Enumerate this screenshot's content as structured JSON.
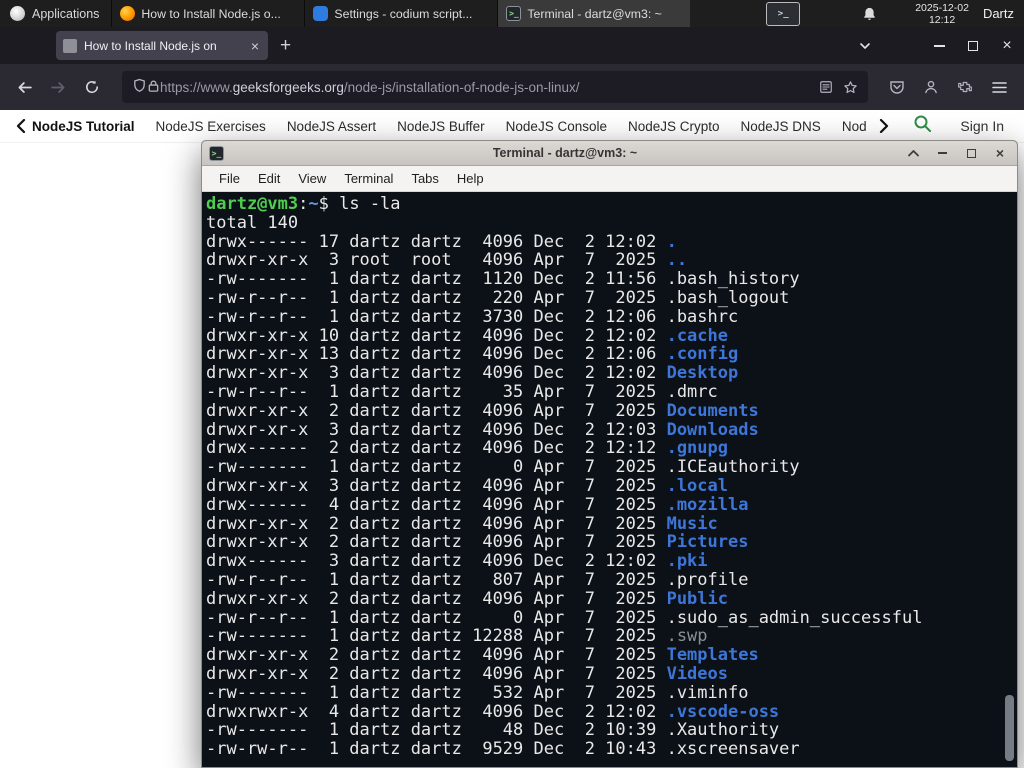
{
  "colors": {
    "gfg_green": "#2f8d46",
    "dir_blue": "#3d76d8",
    "prompt_green": "#4fce4f",
    "terminal_bg": "#0c1117",
    "firefox_dark": "#2b2a33"
  },
  "panel": {
    "applications_label": "Applications",
    "tasks": [
      {
        "title": "How to Install Node.js o...",
        "icon": "firefox",
        "active": false
      },
      {
        "title": "Settings - codium script...",
        "icon": "settings",
        "active": false
      },
      {
        "title": "Terminal - dartz@vm3: ~",
        "icon": "terminal",
        "active": true
      }
    ],
    "tray_glyph": ">_",
    "clock_date": "2025-12-02",
    "clock_time": "12:12",
    "user_label": "Dartz"
  },
  "browser": {
    "tab_title": "How to Install Node.js on",
    "tab_close": "×",
    "new_tab": "+",
    "url_prefix": "https://www.",
    "url_domain": "geeksforgeeks.org",
    "url_path": "/node-js/installation-of-node-js-on-linux/",
    "window_close": "×"
  },
  "sitenav": {
    "items": [
      "NodeJS Tutorial",
      "NodeJS Exercises",
      "NodeJS Assert",
      "NodeJS Buffer",
      "NodeJS Console",
      "NodeJS Crypto",
      "NodeJS DNS",
      "Node"
    ],
    "signin": "Sign In"
  },
  "terminal": {
    "title": "Terminal - dartz@vm3: ~",
    "menus": [
      "File",
      "Edit",
      "View",
      "Terminal",
      "Tabs",
      "Help"
    ],
    "prompt": {
      "userhost": "dartz@vm3",
      "colon": ":",
      "path": "~",
      "dollar": "$ ",
      "command": "ls -la"
    },
    "total_line": "total 140",
    "lines": [
      {
        "pre": "drwx------ 17 dartz dartz  4096 Dec  2 12:02 ",
        "name": ".",
        "c": "dir"
      },
      {
        "pre": "drwxr-xr-x  3 root  root   4096 Apr  7  2025 ",
        "name": "..",
        "c": "dir"
      },
      {
        "pre": "-rw-------  1 dartz dartz  1120 Dec  2 11:56 ",
        "name": ".bash_history",
        "c": "plain"
      },
      {
        "pre": "-rw-r--r--  1 dartz dartz   220 Apr  7  2025 ",
        "name": ".bash_logout",
        "c": "plain"
      },
      {
        "pre": "-rw-r--r--  1 dartz dartz  3730 Dec  2 12:06 ",
        "name": ".bashrc",
        "c": "plain"
      },
      {
        "pre": "drwxr-xr-x 10 dartz dartz  4096 Dec  2 12:02 ",
        "name": ".cache",
        "c": "dir"
      },
      {
        "pre": "drwxr-xr-x 13 dartz dartz  4096 Dec  2 12:06 ",
        "name": ".config",
        "c": "dir"
      },
      {
        "pre": "drwxr-xr-x  3 dartz dartz  4096 Dec  2 12:02 ",
        "name": "Desktop",
        "c": "dir"
      },
      {
        "pre": "-rw-r--r--  1 dartz dartz    35 Apr  7  2025 ",
        "name": ".dmrc",
        "c": "plain"
      },
      {
        "pre": "drwxr-xr-x  2 dartz dartz  4096 Apr  7  2025 ",
        "name": "Documents",
        "c": "dir"
      },
      {
        "pre": "drwxr-xr-x  3 dartz dartz  4096 Dec  2 12:03 ",
        "name": "Downloads",
        "c": "dir"
      },
      {
        "pre": "drwx------  2 dartz dartz  4096 Dec  2 12:12 ",
        "name": ".gnupg",
        "c": "dir"
      },
      {
        "pre": "-rw-------  1 dartz dartz     0 Apr  7  2025 ",
        "name": ".ICEauthority",
        "c": "plain"
      },
      {
        "pre": "drwxr-xr-x  3 dartz dartz  4096 Apr  7  2025 ",
        "name": ".local",
        "c": "dir"
      },
      {
        "pre": "drwx------  4 dartz dartz  4096 Apr  7  2025 ",
        "name": ".mozilla",
        "c": "dir"
      },
      {
        "pre": "drwxr-xr-x  2 dartz dartz  4096 Apr  7  2025 ",
        "name": "Music",
        "c": "dir"
      },
      {
        "pre": "drwxr-xr-x  2 dartz dartz  4096 Apr  7  2025 ",
        "name": "Pictures",
        "c": "dir"
      },
      {
        "pre": "drwx------  3 dartz dartz  4096 Dec  2 12:02 ",
        "name": ".pki",
        "c": "dir"
      },
      {
        "pre": "-rw-r--r--  1 dartz dartz   807 Apr  7  2025 ",
        "name": ".profile",
        "c": "plain"
      },
      {
        "pre": "drwxr-xr-x  2 dartz dartz  4096 Apr  7  2025 ",
        "name": "Public",
        "c": "dir"
      },
      {
        "pre": "-rw-r--r--  1 dartz dartz     0 Apr  7  2025 ",
        "name": ".sudo_as_admin_successful",
        "c": "plain"
      },
      {
        "pre": "-rw-------  1 dartz dartz 12288 Apr  7  2025 ",
        "name": ".swp",
        "c": "dim"
      },
      {
        "pre": "drwxr-xr-x  2 dartz dartz  4096 Apr  7  2025 ",
        "name": "Templates",
        "c": "dir"
      },
      {
        "pre": "drwxr-xr-x  2 dartz dartz  4096 Apr  7  2025 ",
        "name": "Videos",
        "c": "dir"
      },
      {
        "pre": "-rw-------  1 dartz dartz   532 Apr  7  2025 ",
        "name": ".viminfo",
        "c": "plain"
      },
      {
        "pre": "drwxrwxr-x  4 dartz dartz  4096 Dec  2 12:02 ",
        "name": ".vscode-oss",
        "c": "dir"
      },
      {
        "pre": "-rw-------  1 dartz dartz    48 Dec  2 10:39 ",
        "name": ".Xauthority",
        "c": "plain"
      },
      {
        "pre": "-rw-rw-r--  1 dartz dartz  9529 Dec  2 10:43 ",
        "name": ".xscreensaver",
        "c": "plain"
      }
    ]
  }
}
